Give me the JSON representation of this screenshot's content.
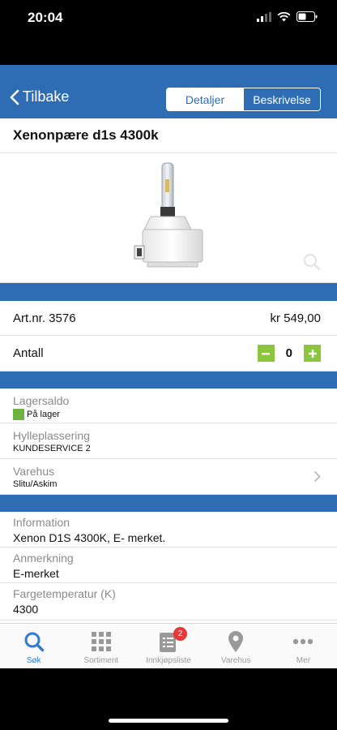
{
  "status_bar": {
    "time": "20:04"
  },
  "nav": {
    "back_label": "Tilbake",
    "tabs": [
      {
        "label": "Detaljer",
        "active": true
      },
      {
        "label": "Beskrivelse",
        "active": false
      }
    ]
  },
  "product": {
    "title": "Xenonpære d1s 4300k",
    "art_nr": "Art.nr. 3576",
    "price": "kr 549,00",
    "quantity_label": "Antall",
    "quantity_value": "0"
  },
  "stock": {
    "lagersaldo_label": "Lagersaldo",
    "lagersaldo_value": "På lager",
    "hylle_label": "Hylleplassering",
    "hylle_value": "KUNDESERVICE 2",
    "varehus_label": "Varehus",
    "varehus_value": "Slitu/Askim"
  },
  "info": {
    "information_label": "Information",
    "information_value": "Xenon D1S 4300K, E- merket.",
    "anmerkning_label": "Anmerkning",
    "anmerkning_value": "E-merket",
    "farge_label": "Fargetemperatur (K)",
    "farge_value": "4300"
  },
  "tabbar": {
    "items": [
      {
        "label": "Søk",
        "icon": "search-icon",
        "active": true
      },
      {
        "label": "Sortiment",
        "icon": "grid-icon",
        "active": false
      },
      {
        "label": "Innkjøpsliste",
        "icon": "list-icon",
        "active": false,
        "badge": "2"
      },
      {
        "label": "Varehus",
        "icon": "location-pin-icon",
        "active": false
      },
      {
        "label": "Mer",
        "icon": "more-icon",
        "active": false
      }
    ]
  },
  "colors": {
    "brand": "#2e6db4",
    "accent_green": "#8cc63f",
    "stock_green": "#6cb33f",
    "active_tab": "#2e7bd6",
    "badge": "#e23b3b"
  }
}
